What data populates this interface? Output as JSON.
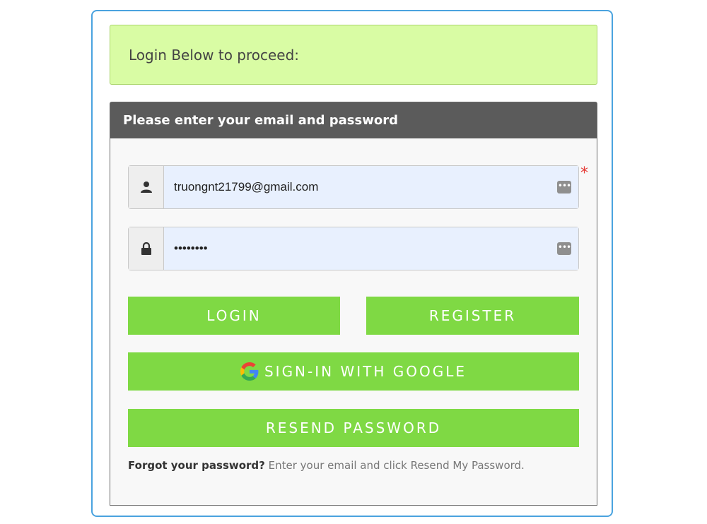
{
  "notice": {
    "text": "Login Below to proceed:"
  },
  "panel": {
    "title": "Please enter your email and password"
  },
  "form": {
    "email_value": "truongnt21799@gmail.com",
    "password_value": "••••••••",
    "required_mark": "*",
    "keeper_glyph": "•••"
  },
  "buttons": {
    "login": "LOGIN",
    "register": "REGISTER",
    "google": "SIGN-IN WITH GOOGLE",
    "resend": "RESEND PASSWORD"
  },
  "help": {
    "bold": "Forgot your password?",
    "text": " Enter your email and click Resend My Password."
  },
  "colors": {
    "accent_green": "#7fd944",
    "notice_bg": "#d9fca4",
    "header_bg": "#5b5b5b",
    "frame_border": "#4aa3df"
  }
}
